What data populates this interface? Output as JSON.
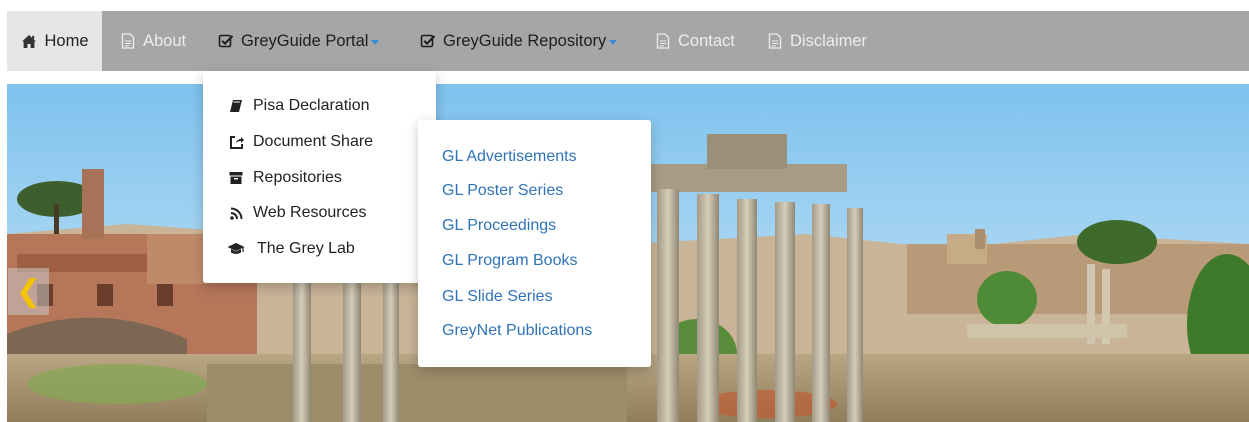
{
  "nav": {
    "items": [
      {
        "label": "Home",
        "icon": "home-icon",
        "active": true
      },
      {
        "label": "About",
        "icon": "document-icon"
      },
      {
        "label": "GreyGuide Portal",
        "icon": "checkbox-icon",
        "dropdown": true
      },
      {
        "label": "GreyGuide Repository",
        "icon": "checkbox-icon",
        "dropdown": true
      },
      {
        "label": "Contact",
        "icon": "document-icon"
      },
      {
        "label": "Disclaimer",
        "icon": "document-icon"
      }
    ],
    "caret_color": "#3a8bd6",
    "bar_color": "#a6a6a6"
  },
  "portal_menu": {
    "items": [
      {
        "label": "Pisa Declaration",
        "icon": "book-icon"
      },
      {
        "label": "Document Share",
        "icon": "share-icon"
      },
      {
        "label": "Repositories",
        "icon": "archive-icon"
      },
      {
        "label": "Web Resources",
        "icon": "rss-icon"
      },
      {
        "label": "The Grey Lab",
        "icon": "graduation-cap-icon"
      }
    ]
  },
  "repository_menu": {
    "items": [
      {
        "label": "GL Advertisements"
      },
      {
        "label": "GL Poster Series"
      },
      {
        "label": "GL Proceedings"
      },
      {
        "label": "GL Program Books"
      },
      {
        "label": "GL Slide Series"
      },
      {
        "label": "GreyNet Publications"
      }
    ],
    "link_color": "#2f73b7"
  },
  "carousel": {
    "prev_glyph": "❮",
    "arrow_color": "#f5c400"
  }
}
